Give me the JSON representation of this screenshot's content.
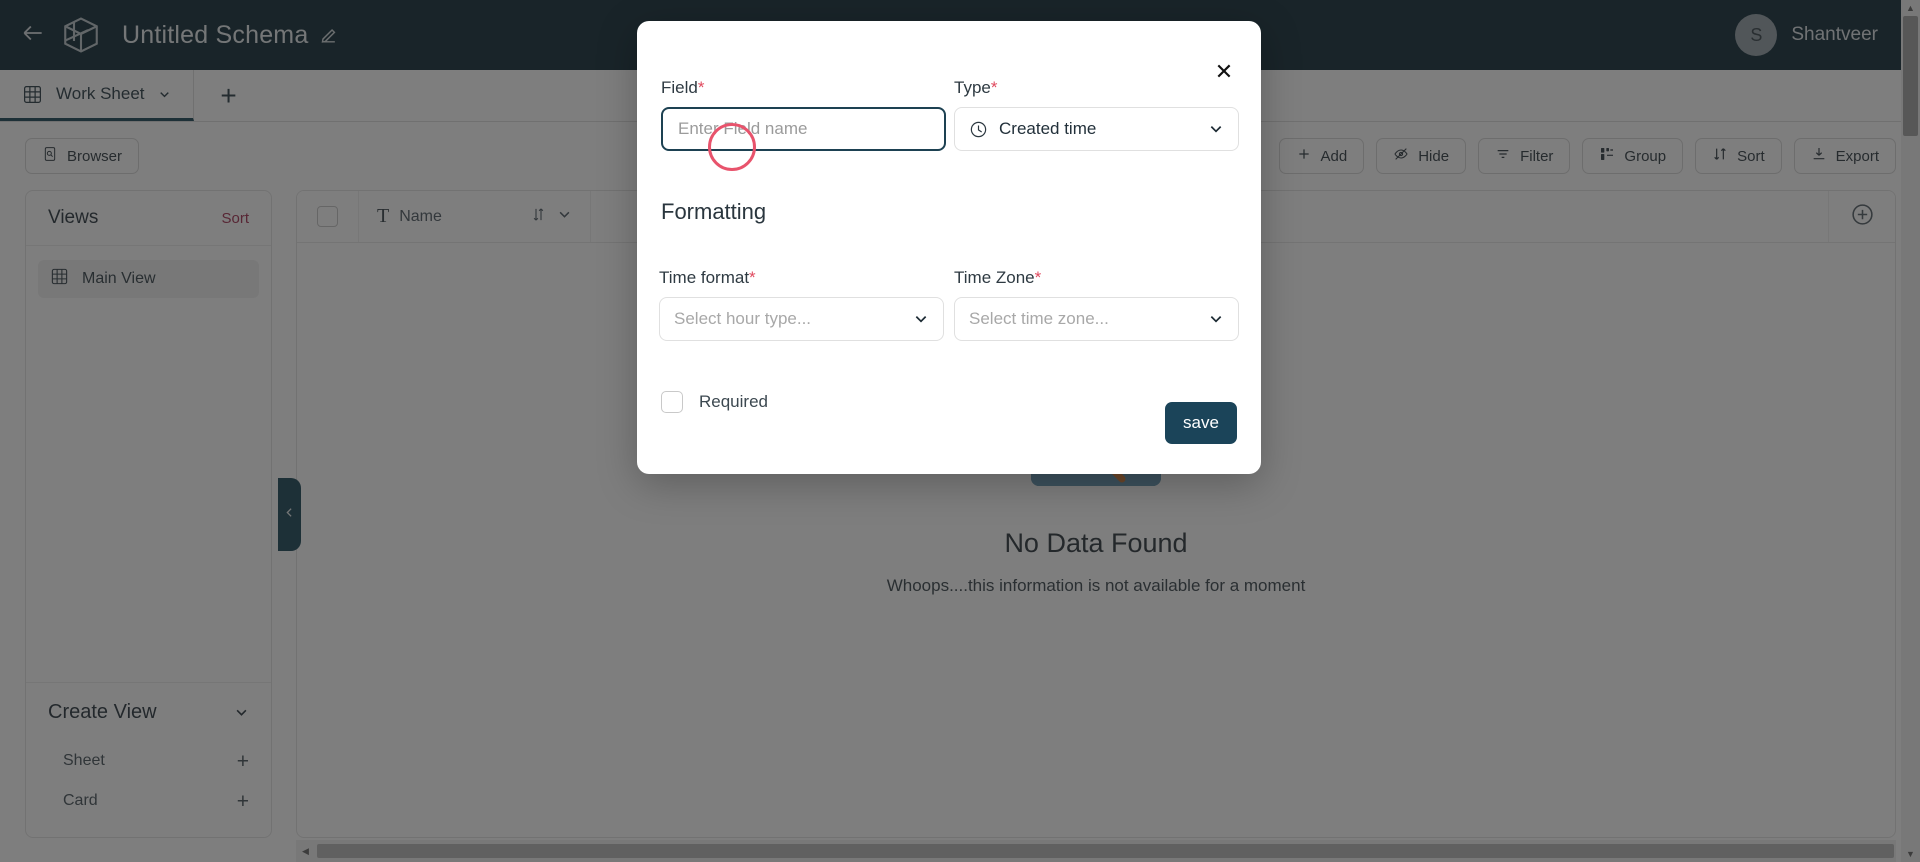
{
  "app": {
    "header": {
      "back_icon": "arrow-left-icon",
      "logo_icon": "cube-logo-icon",
      "schema_title": "Untitled Schema",
      "edit_icon": "pencil-icon",
      "user": {
        "initial": "S",
        "name": "Shantveer"
      },
      "header_bg": "#04202c"
    },
    "tabs": [
      {
        "label": "Work Sheet",
        "icon": "grid-icon",
        "caret": "chevron-down-icon",
        "active": true
      }
    ],
    "tab_add_label": "+",
    "toolbar": {
      "left": [
        {
          "label": "Browser",
          "icon": "browser-icon"
        }
      ],
      "right": [
        {
          "label": "Add",
          "icon": "plus-icon"
        },
        {
          "label": "Hide",
          "icon": "eye-off-icon"
        },
        {
          "label": "Filter",
          "icon": "filter-icon"
        },
        {
          "label": "Group",
          "icon": "group-icon"
        },
        {
          "label": "Sort",
          "icon": "sort-icon"
        },
        {
          "label": "Export",
          "icon": "download-icon"
        }
      ]
    },
    "sidebar": {
      "views_title": "Views",
      "views_sort_label": "Sort",
      "views_sort_color": "#a0264a",
      "views": [
        {
          "label": "Main View",
          "icon": "grid-icon",
          "selected": true
        }
      ],
      "create_view_title": "Create View",
      "create_view_caret": "chevron-down-icon",
      "create_view_items": [
        {
          "label": "Sheet",
          "icon": "grid-icon",
          "add": "+"
        },
        {
          "label": "Card",
          "icon": "card-grid-icon",
          "add": "+"
        }
      ]
    },
    "collapse_handle_icon": "chevron-left-icon",
    "grid": {
      "select_all_icon": "checkbox-icon",
      "columns": [
        {
          "label": "Name",
          "type_icon": "text-type-icon",
          "sort_icon": "sort-updown-icon",
          "menu_icon": "chevron-down-icon"
        }
      ],
      "add_column_icon": "plus-circle-icon",
      "rows": [],
      "empty_state": {
        "art_icon": "folder-search-icon",
        "title": "No Data Found",
        "subtitle": "Whoops....this information is not available for a moment"
      }
    },
    "scrollbars": {
      "h_arrow": "◀",
      "v_up": "▲",
      "v_down": "▼"
    }
  },
  "modal": {
    "close_icon": "close-icon",
    "field": {
      "label": "Field",
      "required_marker": "*",
      "placeholder": "Enter Field name",
      "value": ""
    },
    "type": {
      "label": "Type",
      "required_marker": "*",
      "icon": "clock-icon",
      "value": "Created time",
      "caret": "chevron-down-icon"
    },
    "formatting_title": "Formatting",
    "time_format": {
      "label": "Time format",
      "required_marker": "*",
      "placeholder": "Select hour type...",
      "caret": "chevron-down-icon"
    },
    "time_zone": {
      "label": "Time Zone",
      "required_marker": "*",
      "placeholder": "Select time zone...",
      "caret": "chevron-down-icon"
    },
    "required_checkbox": {
      "label": "Required",
      "checked": false
    },
    "save_button": {
      "label": "save",
      "color": "#1b4459"
    },
    "accent_required_color": "#e04a5f",
    "focus_border_color": "#1d4152"
  },
  "annotation": {
    "click_ring_color": "#e8536c"
  }
}
